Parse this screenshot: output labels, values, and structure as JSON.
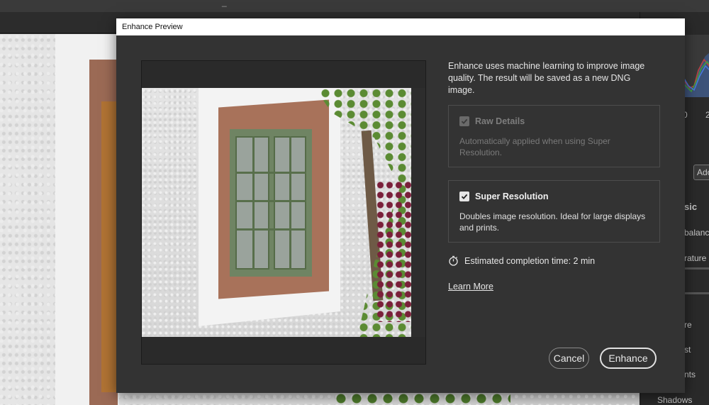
{
  "background_app": {
    "panel_texts": {
      "tick_zero": "0",
      "tick_two": "2",
      "dropdown": "Ado",
      "basic": "sic",
      "white_balance": "balance",
      "temperature": "rature",
      "exposure": "re",
      "contrast": "st",
      "highlights": "nts",
      "shadows": "Shadows"
    },
    "window_minimize_glyph": "_"
  },
  "dialog": {
    "title": "Enhance Preview",
    "description": "Enhance uses machine learning to improve image quality. The result will be saved as a new DNG image.",
    "options": {
      "raw_details": {
        "label": "Raw Details",
        "description": "Automatically applied when using Super Resolution.",
        "checked": true,
        "disabled": true
      },
      "super_resolution": {
        "label": "Super Resolution",
        "description": "Doubles image resolution. Ideal for large displays and prints.",
        "checked": true,
        "disabled": false
      }
    },
    "estimate_text": "Estimated completion time: 2 min",
    "learn_more": "Learn More",
    "buttons": {
      "cancel": "Cancel",
      "enhance": "Enhance"
    },
    "icons": {
      "checkmark": "check-icon",
      "timer": "stopwatch-icon"
    }
  },
  "colors": {
    "dialog_bg": "#333333",
    "titlebar_bg": "#ffffff",
    "text_primary": "#e6e6e6",
    "text_disabled": "#7a7a7a"
  }
}
